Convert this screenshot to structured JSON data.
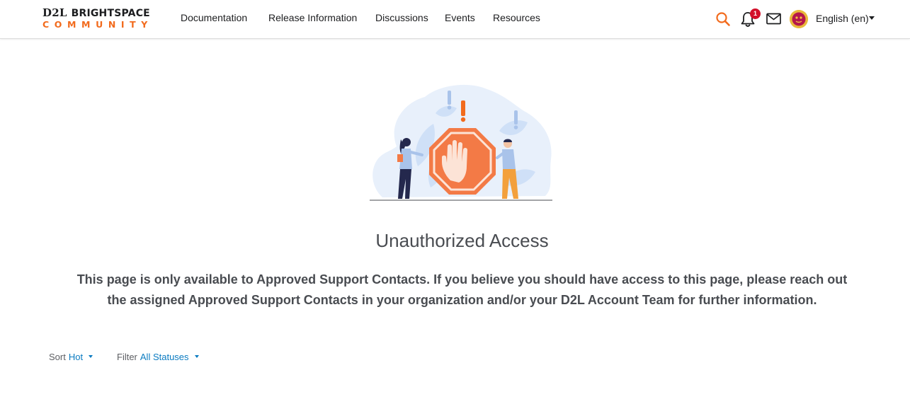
{
  "logo": {
    "top_left": "D2L",
    "top_right": "BRIGHTSPACE",
    "bottom": "COMMUNITY"
  },
  "nav": {
    "items": [
      {
        "label": "Documentation"
      },
      {
        "label": "Release Information"
      },
      {
        "label": "Discussions"
      },
      {
        "label": "Events"
      },
      {
        "label": "Resources"
      }
    ]
  },
  "header": {
    "notification_count": "1",
    "language": "English (en)",
    "icons": [
      "search-icon",
      "bell-icon",
      "mail-icon",
      "avatar",
      "chevron-down-icon"
    ]
  },
  "main": {
    "illustration": "stop-hand-sign-illustration",
    "title": "Unauthorized Access",
    "message_line1": "This page is only available to Approved Support Contacts. If you believe you should have access to this page, please reach out",
    "message_line2": "the assigned Approved Support Contacts in your organization and/or your D2L Account Team for further information."
  },
  "filters": {
    "sort_label": "Sort",
    "sort_value": "Hot",
    "filter_label": "Filter",
    "filter_value": "All Statuses"
  },
  "colors": {
    "brand_orange": "#f26b1d",
    "link_blue": "#0a7bc1",
    "badge_red": "#d3102a",
    "text_gray": "#494c51"
  }
}
